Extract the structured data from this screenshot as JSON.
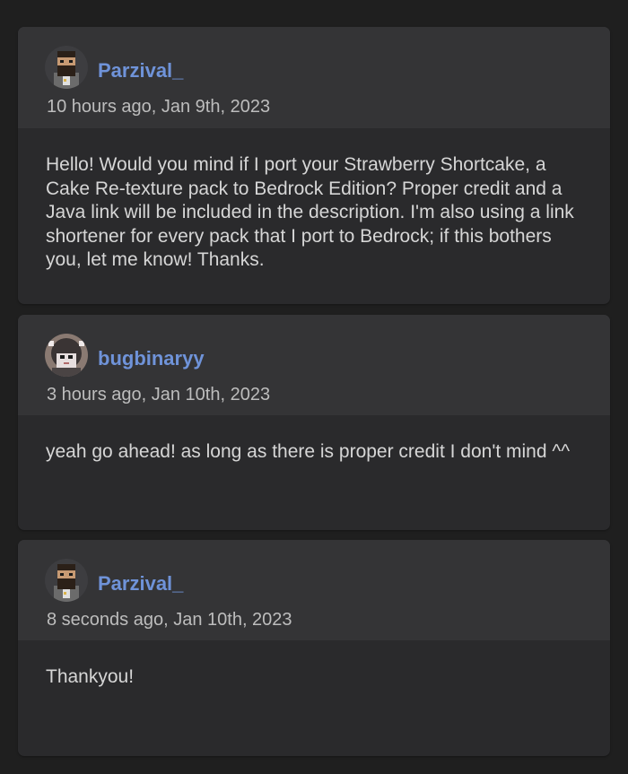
{
  "comments": [
    {
      "username": "Parzival_",
      "avatar_icon": "bearded-man-avatar-icon",
      "timestamp": "10 hours ago, Jan 9th, 2023",
      "body": "Hello! Would you mind if I port your Strawberry Shortcake, a Cake Re-texture pack to Bedrock Edition? Proper credit and a Java link will be included in the description. I'm also using a link shortener for every pack that I port to Bedrock; if this bothers you, let me know! Thanks."
    },
    {
      "username": "bugbinaryy",
      "avatar_icon": "character-avatar-icon",
      "timestamp": "3 hours ago, Jan 10th, 2023",
      "body": "yeah go ahead! as long as there is proper credit I don't mind ^^"
    },
    {
      "username": "Parzival_",
      "avatar_icon": "bearded-man-avatar-icon",
      "timestamp": "8 seconds ago, Jan 10th, 2023",
      "body": "Thankyou!"
    }
  ],
  "colors": {
    "page_background": "#1f1f1f",
    "card_background": "#2a2a2c",
    "header_background": "#343436",
    "username": "#6f93d9",
    "timestamp": "#bdbdbd",
    "body_text": "#d6d6d6"
  }
}
